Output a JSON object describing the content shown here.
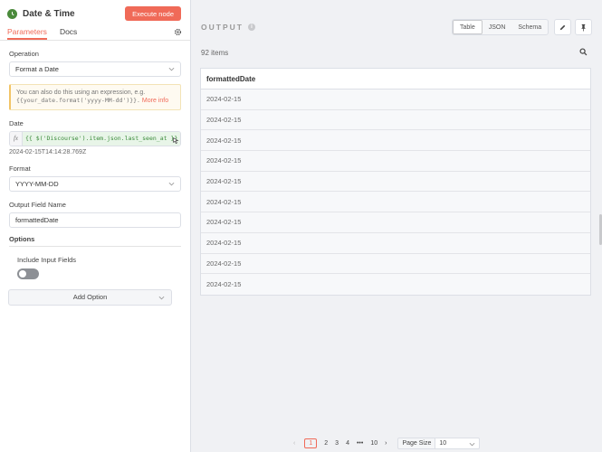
{
  "header": {
    "title": "Date & Time",
    "execute_label": "Execute node"
  },
  "tabs": [
    {
      "label": "Parameters"
    },
    {
      "label": "Docs"
    }
  ],
  "operation": {
    "label": "Operation",
    "value": "Format a Date"
  },
  "notice": {
    "text": "You can also do this using an expression, e.g.",
    "code": "{{your_date.format('yyyy-MM-dd')}}.",
    "more": "More info"
  },
  "date": {
    "label": "Date",
    "fx": "fx",
    "expression": "{{ $('Discourse').item.json.last_seen_at }}",
    "result": "2024-02-15T14:14:28.769Z"
  },
  "format": {
    "label": "Format",
    "value": "YYYY-MM-DD"
  },
  "output_field": {
    "label": "Output Field Name",
    "value": "formattedDate"
  },
  "options": {
    "label": "Options",
    "include_input": "Include Input Fields",
    "add_option": "Add Option"
  },
  "output": {
    "title": "OUTPUT",
    "views": [
      "Table",
      "JSON",
      "Schema"
    ],
    "active_view": "Table",
    "count": "92 items",
    "column": "formattedDate",
    "rows": [
      "2024-02-15",
      "2024-02-15",
      "2024-02-15",
      "2024-02-15",
      "2024-02-15",
      "2024-02-15",
      "2024-02-15",
      "2024-02-15",
      "2024-02-15",
      "2024-02-15"
    ]
  },
  "pagination": {
    "pages": [
      "1",
      "2",
      "3",
      "4",
      "10"
    ],
    "ellipsis": "•••",
    "current": "1",
    "page_size_label": "Page Size",
    "page_size": "10"
  },
  "colors": {
    "accent": "#f06a58",
    "node_icon": "#4a8a3b"
  }
}
